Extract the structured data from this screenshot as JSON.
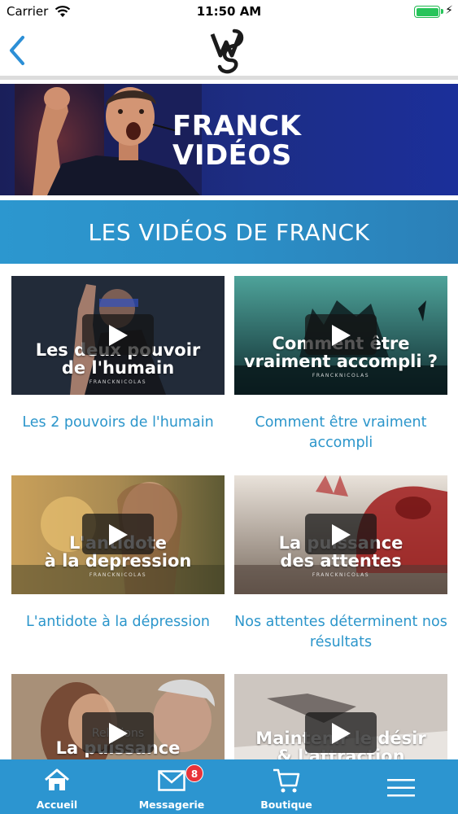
{
  "status_bar": {
    "carrier": "Carrier",
    "time": "11:50 AM",
    "battery_level": 1.0
  },
  "nav": {
    "back_icon": "chevron-left-icon",
    "logo_icon": "wj-logo-icon"
  },
  "hero": {
    "title_line1": "FRANCK",
    "title_line2": "VIDÉOS"
  },
  "section": {
    "title": "LES VIDÉOS DE FRANCK"
  },
  "videos": [
    {
      "thumb_line1": "Les deux pouvoir",
      "thumb_line2": "de l'humain",
      "brand": "FRANCKNICOLAS",
      "caption": "Les 2 pouvoirs de l'humain"
    },
    {
      "thumb_line1": "Comment être",
      "thumb_line2": "vraiment accompli ?",
      "brand": "FRANCKNICOLAS",
      "caption": "Comment être vraiment accompli"
    },
    {
      "thumb_line1": "L'antidote",
      "thumb_line2": "à la depression",
      "brand": "FRANCKNICOLAS",
      "caption": "L'antidote à la dépression"
    },
    {
      "thumb_line1": "La puissance",
      "thumb_line2": "des attentes",
      "brand": "FRANCKNICOLAS",
      "caption": "Nos attentes déterminent nos résultats"
    },
    {
      "thumb_line0": "Relations",
      "thumb_line1": "La puissance",
      "thumb_line2": "",
      "brand": "",
      "caption": ""
    },
    {
      "thumb_line1": "Maintenir le désir",
      "thumb_line2": "& l'attraction",
      "brand": "",
      "caption": ""
    }
  ],
  "tab_bar": {
    "items": [
      {
        "label": "Accueil",
        "icon": "home-icon"
      },
      {
        "label": "Messagerie",
        "icon": "mail-icon",
        "badge": "8"
      },
      {
        "label": "Boutique",
        "icon": "cart-icon"
      },
      {
        "label": "",
        "icon": "menu-icon"
      }
    ]
  },
  "colors": {
    "accent": "#2c96cb",
    "tab_bar": "#2c95d0",
    "badge": "#e8333a",
    "hero_bg": "#1d2d85"
  }
}
